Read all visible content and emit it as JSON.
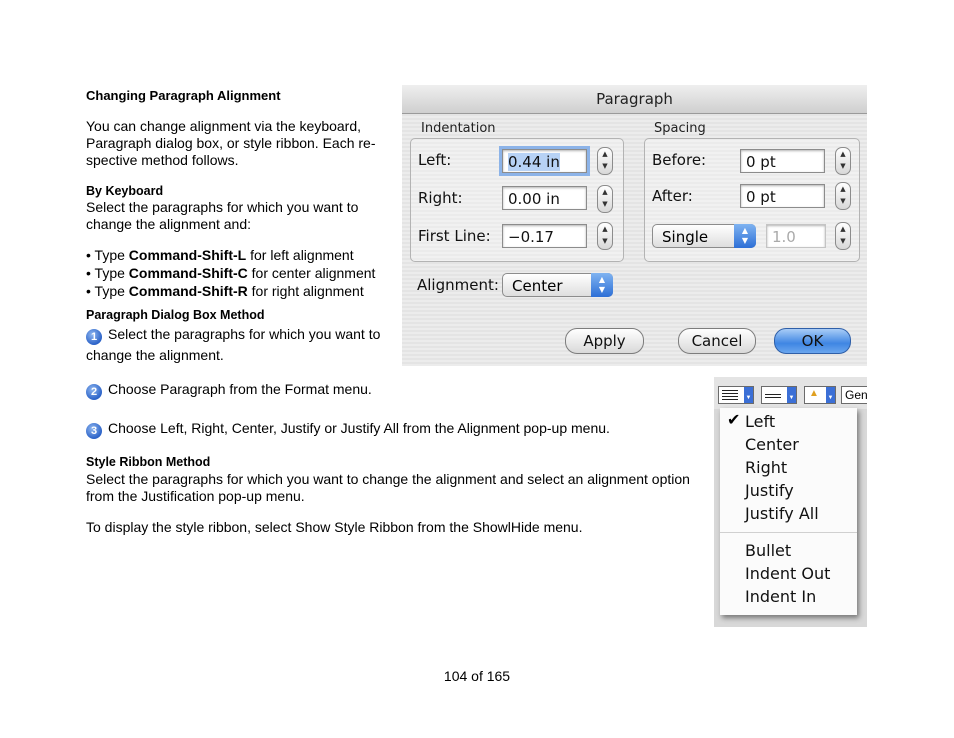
{
  "doc": {
    "heading": "Changing Paragraph Alignment",
    "intro_lines": [
      "You can change alignment via the keyboard,",
      "Paragraph dialog box, or style ribbon. Each re-",
      "spective method follows."
    ],
    "by_keyboard": {
      "heading": "By Keyboard",
      "lines": [
        "Select the paragraphs for which you want to",
        "change the alignment and:"
      ],
      "bullets": [
        {
          "pre": "• Type ",
          "key": "Command-Shift-L",
          "post": " for left alignment"
        },
        {
          "pre": "• Type ",
          "key": "Command-Shift-C",
          "post": " for center alignment"
        },
        {
          "pre": "• Type ",
          "key": "Command-Shift-R",
          "post": " for right alignment"
        }
      ]
    },
    "dialog_method": {
      "heading": "Paragraph Dialog Box Method",
      "steps": [
        {
          "num": "1",
          "line1": "Select the paragraphs for which you want to",
          "line2": "change the alignment."
        },
        {
          "num": "2",
          "line1": "Choose Paragraph from the Format menu."
        },
        {
          "num": "3",
          "line1": "Choose Left, Right, Center, Justify or Justify All from the Alignment pop-up menu."
        }
      ]
    },
    "ribbon_method": {
      "heading": "Style Ribbon Method",
      "lines": [
        "Select the paragraphs for which you want to change the alignment and select an alignment option",
        "from the Justification pop-up menu."
      ],
      "note": "To display the style ribbon, select Show Style Ribbon from the ShowlHide menu."
    },
    "page_number": "104 of 165"
  },
  "dialog": {
    "title": "Paragraph",
    "indentation": {
      "label": "Indentation",
      "left_label": "Left:",
      "left_value": "0.44 in",
      "right_label": "Right:",
      "right_value": "0.00 in",
      "first_line_label": "First Line:",
      "first_line_value": "−0.17"
    },
    "spacing": {
      "label": "Spacing",
      "before_label": "Before:",
      "before_value": "0 pt",
      "after_label": "After:",
      "after_value": "0 pt",
      "line_spacing": "Single",
      "line_value": "1.0"
    },
    "alignment_label": "Alignment:",
    "alignment_value": "Center",
    "buttons": {
      "apply": "Apply",
      "cancel": "Cancel",
      "ok": "OK"
    }
  },
  "ribbon": {
    "partial_label": "Gen",
    "menu_items": [
      "Left",
      "Center",
      "Right",
      "Justify",
      "Justify All",
      "Bullet",
      "Indent Out",
      "Indent In"
    ],
    "checked": "✔",
    "accent": "#3b6fd6"
  }
}
